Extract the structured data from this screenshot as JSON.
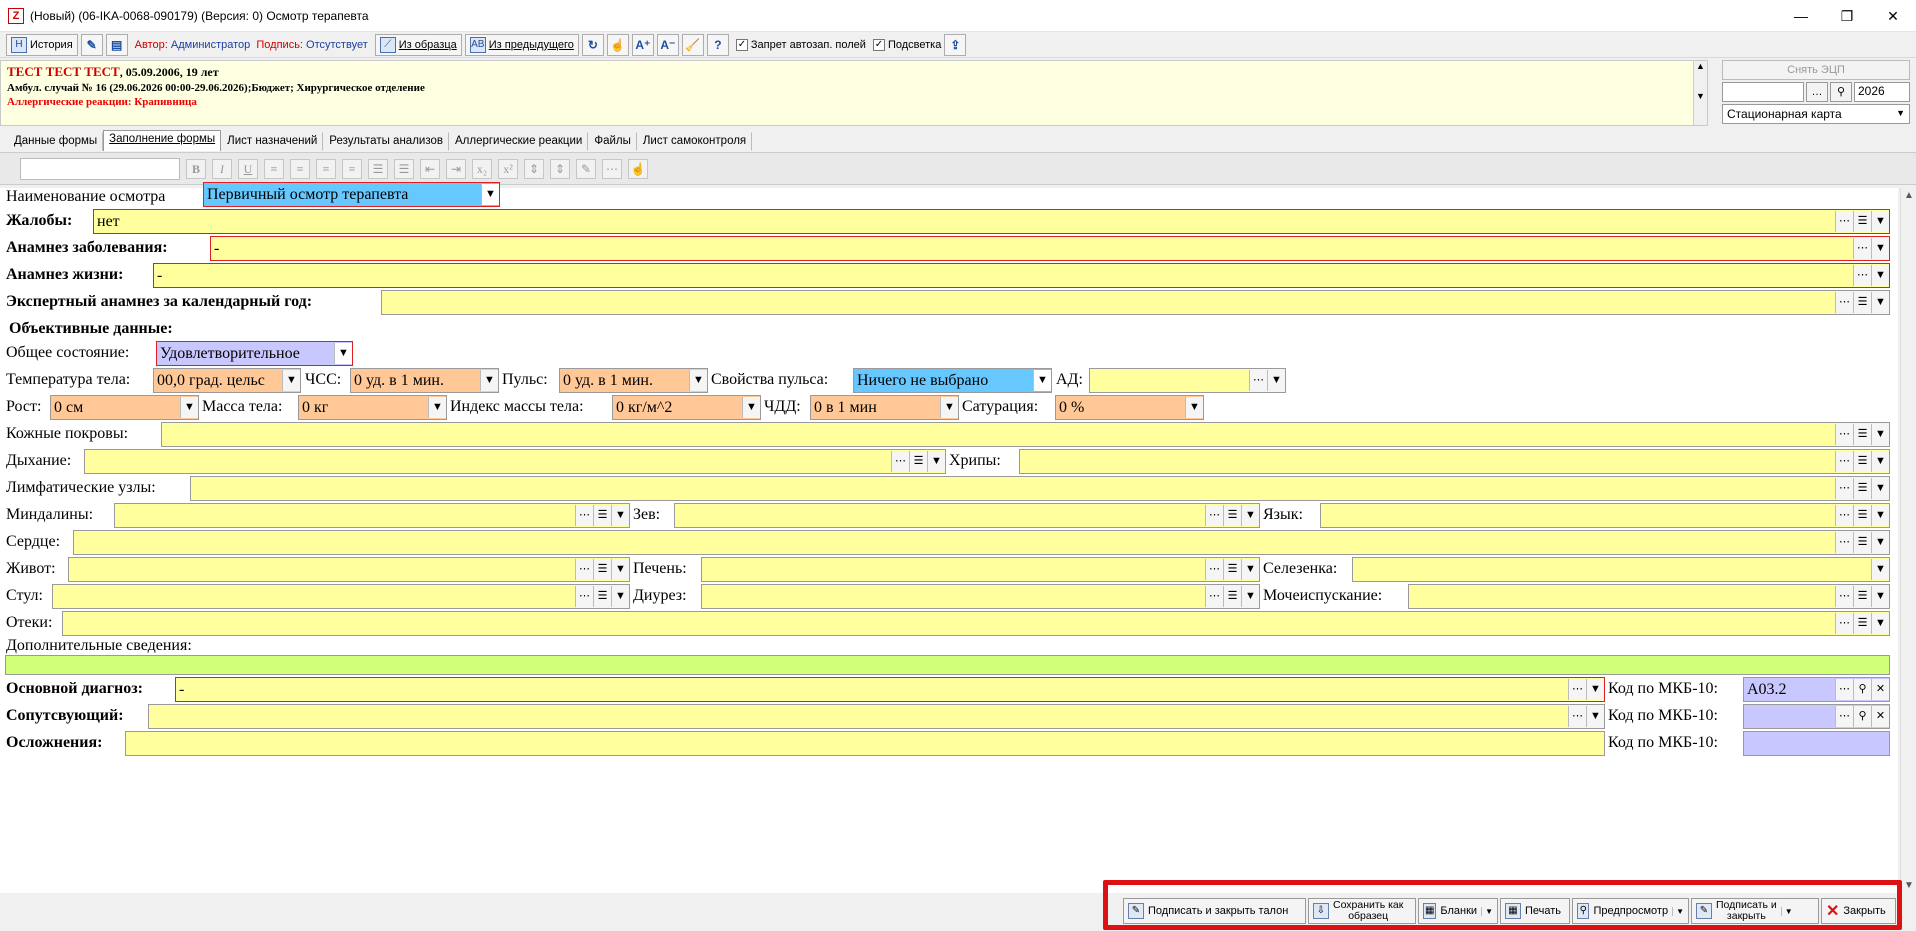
{
  "window": {
    "title": "(Новый) (06-IKA-0068-090179) (Версия: 0) Осмотр терапевта"
  },
  "toolbar": {
    "history": "История",
    "author_label": "Автор:",
    "author_value": "Администратор",
    "sign_label": "Подпись:",
    "sign_value": "Отсутствует",
    "from_template": "Из образца",
    "from_previous": "Из предыдущего",
    "autofill_ban": "Запрет автозап. полей",
    "highlight": "Подсветка"
  },
  "patient": {
    "name": "ТЕСТ ТЕСТ ТЕСТ",
    "dob_age": ", 05.09.2006, 19 лет",
    "case": "Амбул. случай  № 16 (29.06.2026 00:00-29.06.2026);Бюджет; Хирургическое отделение",
    "allergy": "Аллергические реакции: Крапивница"
  },
  "right_panel": {
    "ecp": "Снять ЭЦП",
    "year": "2026",
    "card": "Стационарная карта"
  },
  "tabs": [
    "Данные формы",
    "Заполнение формы",
    "Лист назначений",
    "Результаты анализов",
    "Аллергические реакции",
    "Файлы",
    "Лист самоконтроля"
  ],
  "form": {
    "exam_name_label": "Наименование осмотра",
    "exam_name_value": "Первичный осмотр терапевта",
    "complaints_label": "Жалобы:",
    "complaints_value": "нет",
    "anamnesis_disease_label": "Анамнез заболевания:",
    "anamnesis_disease_value": "-",
    "anamnesis_life_label": "Анамнез жизни:",
    "anamnesis_life_value": "-",
    "expert_label": "Экспертный анамнез за календарный год:",
    "objective_label": "Объективные данные:",
    "general_state_label": "Общее состояние:",
    "general_state_value": "Удовлетворительное",
    "temp_label": "Температура тела:",
    "temp_value": "00,0 град. цельс",
    "hr_label": "ЧСС:",
    "hr_value": "0 уд. в 1 мин.",
    "pulse_label": "Пульс:",
    "pulse_value": "0 уд. в 1 мин.",
    "pulse_props_label": "Свойства пульса:",
    "pulse_props_value": "Ничего не выбрано",
    "bp_label": "АД:",
    "height_label": "Рост:",
    "height_value": "0 см",
    "weight_label": "Масса тела:",
    "weight_value": "0 кг",
    "bmi_label": "Индекс массы тела:",
    "bmi_value": "0 кг/м^2",
    "rr_label": "ЧДД:",
    "rr_value": "0 в 1 мин",
    "sat_label": "Сатурация:",
    "sat_value": "0 %",
    "skin_label": "Кожные покровы:",
    "breath_label": "Дыхание:",
    "rales_label": "Хрипы:",
    "lymph_label": "Лимфатические узлы:",
    "tonsils_label": "Миндалины:",
    "throat_label": "Зев:",
    "tongue_label": "Язык:",
    "heart_label": "Сердце:",
    "belly_label": "Живот:",
    "liver_label": "Печень:",
    "spleen_label": "Селезенка:",
    "stool_label": "Стул:",
    "diuresis_label": "Диурез:",
    "urination_label": "Мочеиспускание:",
    "edema_label": "Отеки:",
    "extra_label": "Дополнительные сведения:",
    "main_dx_label": "Основной диагноз:",
    "main_dx_value": "-",
    "mkb_label": "Код по МКБ-10:",
    "mkb_value": "A03.2",
    "concomitant_label": "Сопутсвующий:",
    "complications_label": "Осложнения:"
  },
  "footer": {
    "sign_close_ticket": "Подписать и закрыть талон",
    "save_template_1": "Сохранить как",
    "save_template_2": "образец",
    "blanks": "Бланки",
    "print": "Печать",
    "preview": "Предпросмотр",
    "sign_close_1": "Подписать и",
    "sign_close_2": "закрыть",
    "close": "Закрыть"
  },
  "colors": {
    "field": "#ffff9e",
    "numeric": "#ffc896",
    "select": "#66c8ff",
    "accent_red": "#e02020"
  }
}
